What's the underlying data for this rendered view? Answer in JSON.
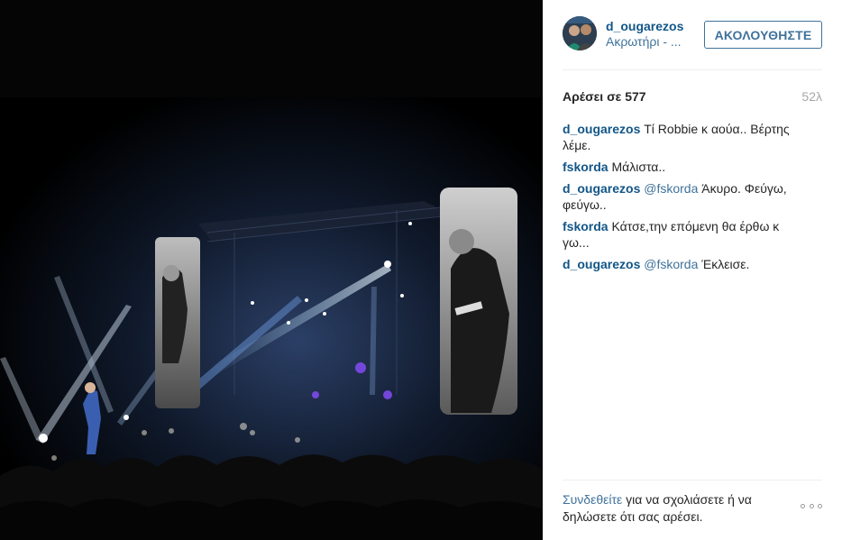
{
  "post": {
    "photo": {
      "alt": "Concert stage with lights and screens"
    },
    "author": {
      "username": "d_ougarezos",
      "location": "Ακρωτήρι - ..."
    },
    "follow_label": "ΑΚΟΛΟΥΘΗΣΤΕ",
    "likes_text": "Αρέσει σε 577",
    "time_ago": "52λ",
    "comments": [
      {
        "author": "d_ougarezos",
        "mention": "",
        "text": "Τί Robbie κ αούα.. Βέρτης λέμε."
      },
      {
        "author": "fskorda",
        "mention": "",
        "text": "Μάλιστα.."
      },
      {
        "author": "d_ougarezos",
        "mention": "@fskorda",
        "text": "Άκυρο. Φεύγω, φεύγω.."
      },
      {
        "author": "fskorda",
        "mention": "",
        "text": "Κάτσε,την επόμενη θα έρθω κ γω..."
      },
      {
        "author": "d_ougarezos",
        "mention": "@fskorda",
        "text": "Έκλεισε."
      }
    ],
    "footer": {
      "login_link": "Συνδεθείτε",
      "login_text": "για να σχολιάσετε ή να δηλώσετε ότι σας αρέσει."
    },
    "colors": {
      "link_blue": "#125688",
      "accent_blue": "#3f729b",
      "muted_gray": "#a5a7aa"
    }
  }
}
